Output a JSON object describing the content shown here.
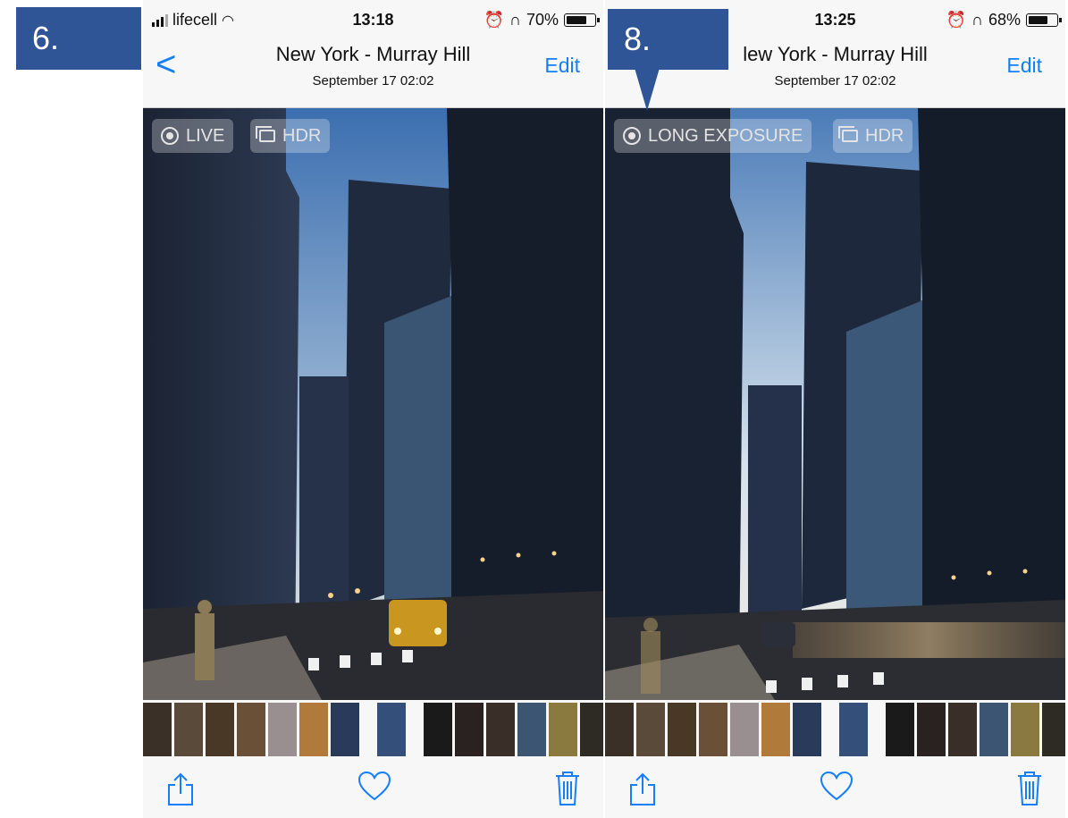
{
  "labels": {
    "left": "6.",
    "right": "8."
  },
  "colors": {
    "accent": "#147efb",
    "label_bg": "#2f5597"
  },
  "phones": [
    {
      "status": {
        "carrier": "lifecell",
        "time": "13:18",
        "battery": "70%",
        "battery_level": 0.7
      },
      "nav": {
        "back": "<",
        "title": "New York - Murray Hill",
        "subtitle": "September 17  02:02",
        "edit": "Edit"
      },
      "badges": [
        "LIVE",
        "HDR"
      ],
      "toolbar": [
        "share-icon",
        "heart-icon",
        "trash-icon"
      ]
    },
    {
      "status": {
        "carrier": "",
        "time": "13:25",
        "battery": "68%",
        "battery_level": 0.68
      },
      "nav": {
        "title": "lew York - Murray Hill",
        "subtitle": "September 17  02:02",
        "edit": "Edit"
      },
      "badges": [
        "LONG EXPOSURE",
        "HDR"
      ],
      "toolbar": [
        "share-icon",
        "heart-icon",
        "trash-icon"
      ]
    }
  ]
}
